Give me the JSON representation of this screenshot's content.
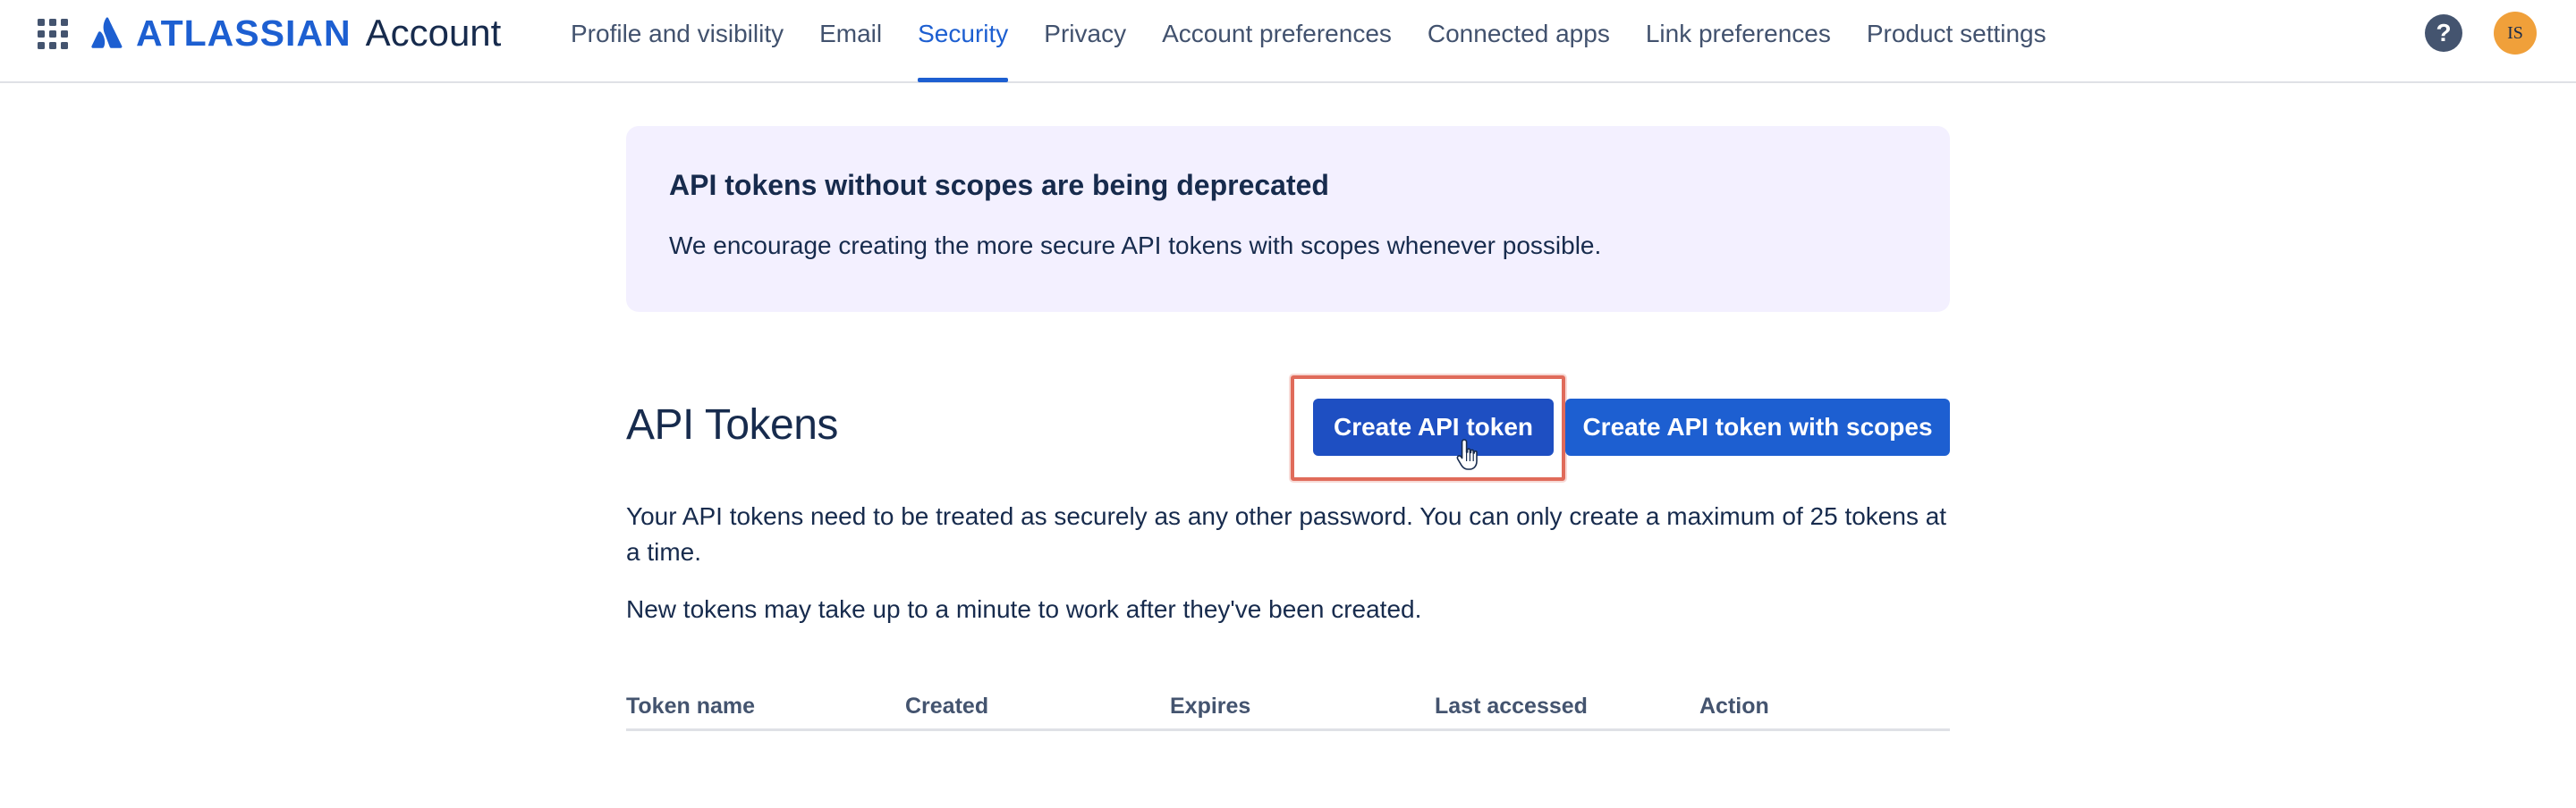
{
  "header": {
    "logo_text": "ATLASSIAN",
    "product_text": "Account",
    "tabs": [
      {
        "label": "Profile and visibility",
        "active": false
      },
      {
        "label": "Email",
        "active": false
      },
      {
        "label": "Security",
        "active": true
      },
      {
        "label": "Privacy",
        "active": false
      },
      {
        "label": "Account preferences",
        "active": false
      },
      {
        "label": "Connected apps",
        "active": false
      },
      {
        "label": "Link preferences",
        "active": false
      },
      {
        "label": "Product settings",
        "active": false
      }
    ],
    "help_label": "?",
    "avatar_initials": "IS"
  },
  "banner": {
    "title": "API tokens without scopes are being deprecated",
    "body": "We encourage creating the more secure API tokens with scopes whenever possible."
  },
  "section": {
    "title": "API Tokens",
    "create_button": "Create API token",
    "create_scopes_button": "Create API token with scopes",
    "description_1": "Your API tokens need to be treated as securely as any other password. You can only create a maximum of 25 tokens at a time.",
    "description_2": "New tokens may take up to a minute to work after they've been created."
  },
  "table": {
    "columns": [
      "Token name",
      "Created",
      "Expires",
      "Last accessed",
      "Action"
    ]
  },
  "colors": {
    "brand_blue": "#1d5fd1",
    "banner_bg": "#f3f0ff",
    "highlight": "#e06b5a",
    "avatar_bg": "#f0a03a"
  }
}
